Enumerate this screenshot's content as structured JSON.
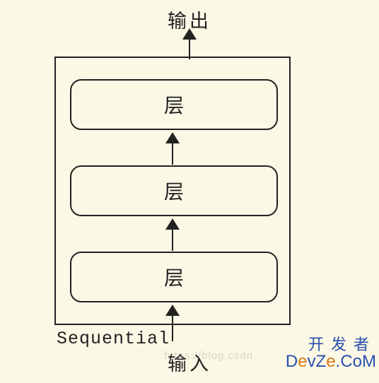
{
  "diagram": {
    "output_label": "输出",
    "input_label": "输入",
    "container_label": "Sequential",
    "layers": [
      "层",
      "层",
      "层"
    ]
  },
  "watermark": {
    "line1": "开发者",
    "line2_pre": "D",
    "line2_e1": "e",
    "line2_mid": "vZ",
    "line2_e2": "e",
    "line2_post": ".CoM",
    "csdn": "https://blog.csdn"
  }
}
